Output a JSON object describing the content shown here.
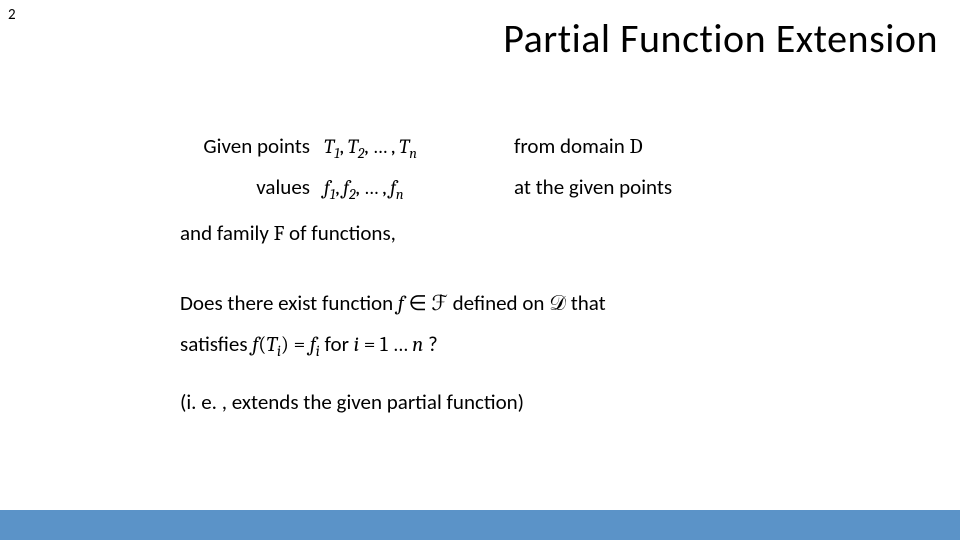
{
  "page_number": "2",
  "title": "Partial Function Extension",
  "row1": {
    "lead": "Given points",
    "t1": "T",
    "s1": "1",
    "t2": "T",
    "s2": "2",
    "dots": "…",
    "tn": "T",
    "sn": "n",
    "trail": "from domain ",
    "domain": "D"
  },
  "row2": {
    "lead": "values",
    "f1": "f",
    "s1": "1",
    "f2": "f",
    "s2": "2",
    "dots": "…",
    "fn": "f",
    "sn": "n",
    "trail": "at the given points"
  },
  "family": {
    "pre": "and family ",
    "F": "F",
    "post": " of functions,"
  },
  "question": {
    "l1a": "Does there exist function ",
    "f": "f",
    "in": " ∈ ",
    "Fcal": "ℱ",
    "defined": " defined on ",
    "Dcal": "𝒟",
    "that": " that",
    "l2a": "satisfies ",
    "fT": "f",
    "lpar": "(",
    "Ti": "T",
    "Ti_sub": "i",
    "rpar": ")",
    "eq": " = ",
    "fi": "f",
    "fi_sub": "i",
    "for": " for ",
    "ivar": "i",
    "eq2": " = 1 … ",
    "n": "n",
    "qmark": " ?"
  },
  "note": "(i. e. , extends the given partial function)",
  "chart_data": null
}
